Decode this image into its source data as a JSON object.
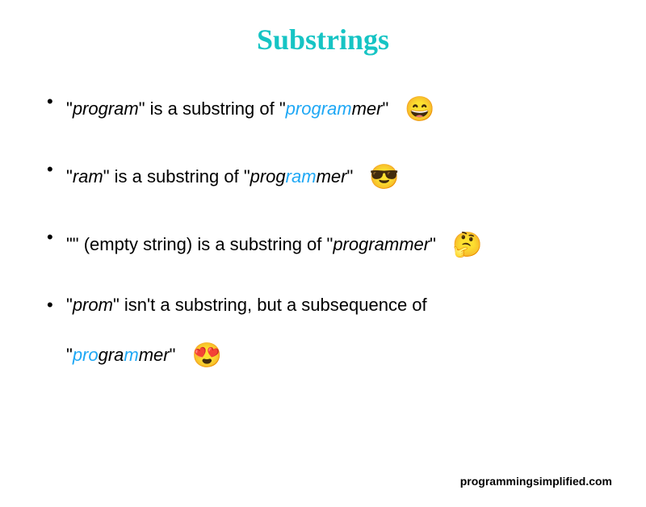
{
  "title": "Substrings",
  "items": [
    {
      "q1": "\"",
      "sub": "program",
      "q2": "\" is a substring of \"",
      "pre": "program",
      "rest": "mer",
      "q3": "\"",
      "emoji": "😄"
    },
    {
      "q1": "\"",
      "sub": "ram",
      "q2": "\" is a substring of \"",
      "pre": "prog",
      "mid": "ram",
      "rest": "mer",
      "q3": "\"",
      "emoji": "😎"
    },
    {
      "text": "\"\" (empty string) is a substring of \"",
      "word": "programmer",
      "q3": "\"",
      "emoji": "🤔"
    },
    {
      "q1": "\"",
      "sub": "prom",
      "q2": "\" isn't a substring, but a subsequence of",
      "line2q": "\"",
      "p1": "pro",
      "p2": "gra",
      "p3": "m",
      "p4": "mer",
      "line2q2": "\"",
      "emoji": "😍"
    }
  ],
  "footer": "programmingsimplified.com"
}
